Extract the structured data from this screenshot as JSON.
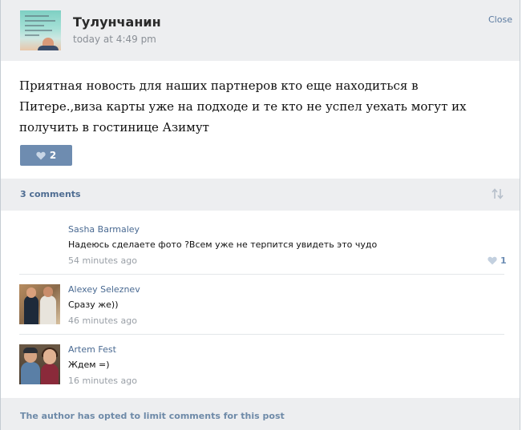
{
  "post": {
    "author": "Тулунчанин",
    "time": "today at 4:49 pm",
    "close_label": "Close",
    "text": "Приятная новость для наших партнеров кто еще находиться в Питере.,виза карты уже на подходе и те кто не успел уехать могут их получить в гостинице Азимут",
    "likes": "2"
  },
  "comments_header": {
    "count_label": "3 comments"
  },
  "comments": [
    {
      "name": "Sasha Barmaley",
      "text": "Надеюсь сделаете фото ?Всем уже не терпится увидеть это чудо",
      "time": "54 minutes ago",
      "likes": "1"
    },
    {
      "name": "Alexey Seleznev",
      "text": "Сразу же))",
      "time": "46 minutes ago"
    },
    {
      "name": "Artem Fest",
      "text": "Ждем =)",
      "time": "16 minutes ago"
    }
  ],
  "footer": {
    "text": "The author has opted to limit comments for this post"
  },
  "colors": {
    "accent": "#6e8cb0",
    "link": "#4a6a92",
    "panel": "#edeef0"
  },
  "icons": [
    "heart-icon",
    "sort-icon"
  ]
}
